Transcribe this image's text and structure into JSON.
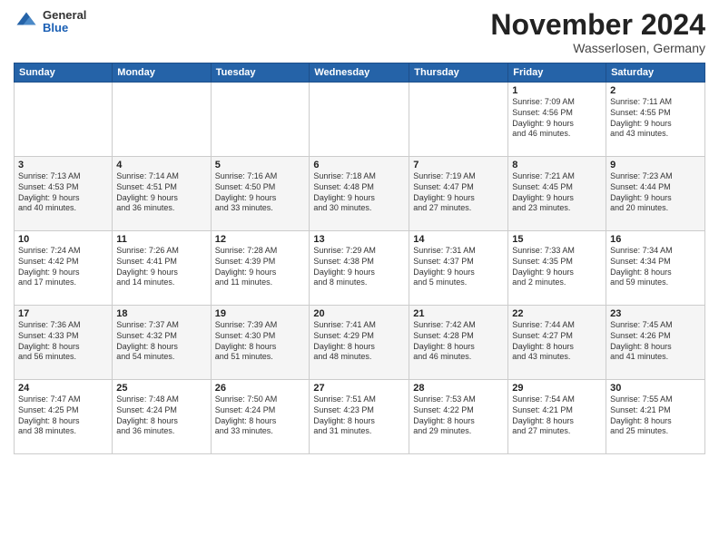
{
  "header": {
    "logo_general": "General",
    "logo_blue": "Blue",
    "title": "November 2024",
    "location": "Wasserlosen, Germany"
  },
  "calendar": {
    "weekdays": [
      "Sunday",
      "Monday",
      "Tuesday",
      "Wednesday",
      "Thursday",
      "Friday",
      "Saturday"
    ],
    "weeks": [
      [
        {
          "day": "",
          "info": ""
        },
        {
          "day": "",
          "info": ""
        },
        {
          "day": "",
          "info": ""
        },
        {
          "day": "",
          "info": ""
        },
        {
          "day": "",
          "info": ""
        },
        {
          "day": "1",
          "info": "Sunrise: 7:09 AM\nSunset: 4:56 PM\nDaylight: 9 hours\nand 46 minutes."
        },
        {
          "day": "2",
          "info": "Sunrise: 7:11 AM\nSunset: 4:55 PM\nDaylight: 9 hours\nand 43 minutes."
        }
      ],
      [
        {
          "day": "3",
          "info": "Sunrise: 7:13 AM\nSunset: 4:53 PM\nDaylight: 9 hours\nand 40 minutes."
        },
        {
          "day": "4",
          "info": "Sunrise: 7:14 AM\nSunset: 4:51 PM\nDaylight: 9 hours\nand 36 minutes."
        },
        {
          "day": "5",
          "info": "Sunrise: 7:16 AM\nSunset: 4:50 PM\nDaylight: 9 hours\nand 33 minutes."
        },
        {
          "day": "6",
          "info": "Sunrise: 7:18 AM\nSunset: 4:48 PM\nDaylight: 9 hours\nand 30 minutes."
        },
        {
          "day": "7",
          "info": "Sunrise: 7:19 AM\nSunset: 4:47 PM\nDaylight: 9 hours\nand 27 minutes."
        },
        {
          "day": "8",
          "info": "Sunrise: 7:21 AM\nSunset: 4:45 PM\nDaylight: 9 hours\nand 23 minutes."
        },
        {
          "day": "9",
          "info": "Sunrise: 7:23 AM\nSunset: 4:44 PM\nDaylight: 9 hours\nand 20 minutes."
        }
      ],
      [
        {
          "day": "10",
          "info": "Sunrise: 7:24 AM\nSunset: 4:42 PM\nDaylight: 9 hours\nand 17 minutes."
        },
        {
          "day": "11",
          "info": "Sunrise: 7:26 AM\nSunset: 4:41 PM\nDaylight: 9 hours\nand 14 minutes."
        },
        {
          "day": "12",
          "info": "Sunrise: 7:28 AM\nSunset: 4:39 PM\nDaylight: 9 hours\nand 11 minutes."
        },
        {
          "day": "13",
          "info": "Sunrise: 7:29 AM\nSunset: 4:38 PM\nDaylight: 9 hours\nand 8 minutes."
        },
        {
          "day": "14",
          "info": "Sunrise: 7:31 AM\nSunset: 4:37 PM\nDaylight: 9 hours\nand 5 minutes."
        },
        {
          "day": "15",
          "info": "Sunrise: 7:33 AM\nSunset: 4:35 PM\nDaylight: 9 hours\nand 2 minutes."
        },
        {
          "day": "16",
          "info": "Sunrise: 7:34 AM\nSunset: 4:34 PM\nDaylight: 8 hours\nand 59 minutes."
        }
      ],
      [
        {
          "day": "17",
          "info": "Sunrise: 7:36 AM\nSunset: 4:33 PM\nDaylight: 8 hours\nand 56 minutes."
        },
        {
          "day": "18",
          "info": "Sunrise: 7:37 AM\nSunset: 4:32 PM\nDaylight: 8 hours\nand 54 minutes."
        },
        {
          "day": "19",
          "info": "Sunrise: 7:39 AM\nSunset: 4:30 PM\nDaylight: 8 hours\nand 51 minutes."
        },
        {
          "day": "20",
          "info": "Sunrise: 7:41 AM\nSunset: 4:29 PM\nDaylight: 8 hours\nand 48 minutes."
        },
        {
          "day": "21",
          "info": "Sunrise: 7:42 AM\nSunset: 4:28 PM\nDaylight: 8 hours\nand 46 minutes."
        },
        {
          "day": "22",
          "info": "Sunrise: 7:44 AM\nSunset: 4:27 PM\nDaylight: 8 hours\nand 43 minutes."
        },
        {
          "day": "23",
          "info": "Sunrise: 7:45 AM\nSunset: 4:26 PM\nDaylight: 8 hours\nand 41 minutes."
        }
      ],
      [
        {
          "day": "24",
          "info": "Sunrise: 7:47 AM\nSunset: 4:25 PM\nDaylight: 8 hours\nand 38 minutes."
        },
        {
          "day": "25",
          "info": "Sunrise: 7:48 AM\nSunset: 4:24 PM\nDaylight: 8 hours\nand 36 minutes."
        },
        {
          "day": "26",
          "info": "Sunrise: 7:50 AM\nSunset: 4:24 PM\nDaylight: 8 hours\nand 33 minutes."
        },
        {
          "day": "27",
          "info": "Sunrise: 7:51 AM\nSunset: 4:23 PM\nDaylight: 8 hours\nand 31 minutes."
        },
        {
          "day": "28",
          "info": "Sunrise: 7:53 AM\nSunset: 4:22 PM\nDaylight: 8 hours\nand 29 minutes."
        },
        {
          "day": "29",
          "info": "Sunrise: 7:54 AM\nSunset: 4:21 PM\nDaylight: 8 hours\nand 27 minutes."
        },
        {
          "day": "30",
          "info": "Sunrise: 7:55 AM\nSunset: 4:21 PM\nDaylight: 8 hours\nand 25 minutes."
        }
      ]
    ]
  }
}
